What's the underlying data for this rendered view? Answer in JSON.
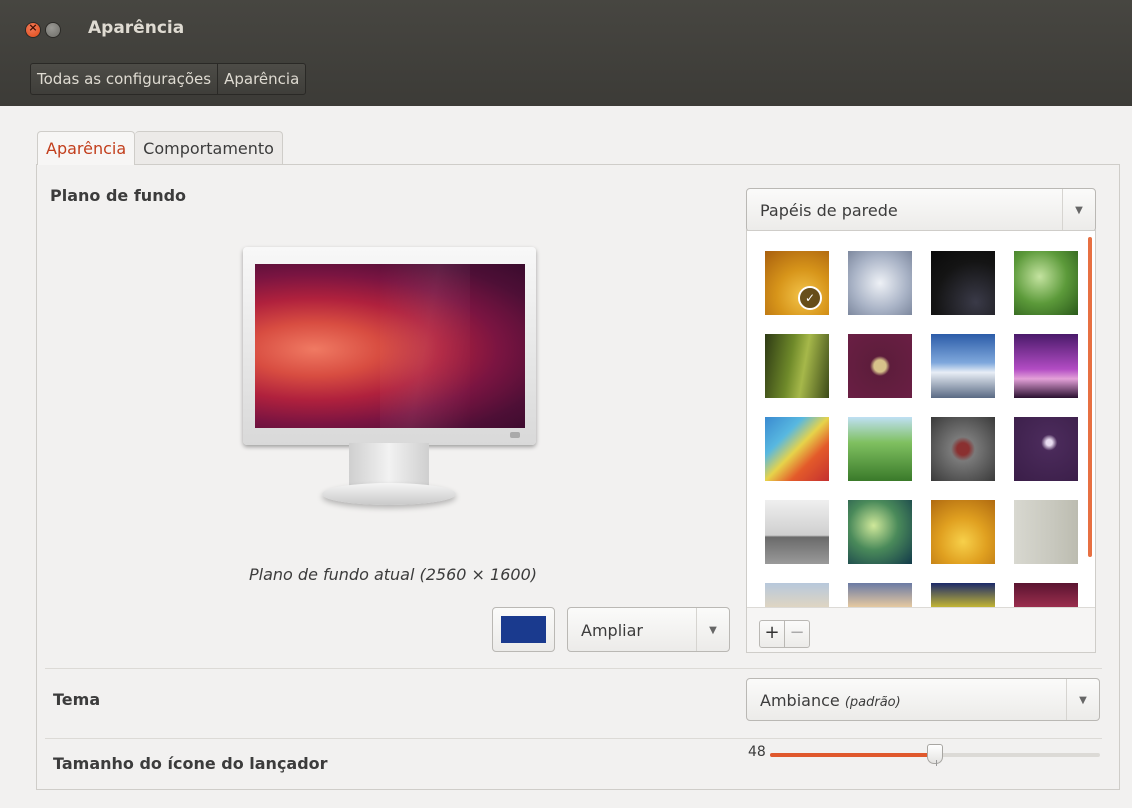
{
  "window": {
    "title": "Aparência"
  },
  "breadcrumb": [
    "Todas as configurações",
    "Aparência"
  ],
  "tabs": [
    {
      "label": "Aparência",
      "active": true
    },
    {
      "label": "Comportamento",
      "active": false
    }
  ],
  "background": {
    "section_label": "Plano de fundo",
    "source_dropdown": "Papéis de parede",
    "caption": "Plano de fundo atual (2560 × 1600)",
    "color_swatch": "#1a3a8e",
    "mode_dropdown": "Ampliar",
    "add_label": "+",
    "remove_label": "−"
  },
  "theme": {
    "label": "Tema",
    "value": "Ambiance",
    "value_note": "(padrão)"
  },
  "launcher": {
    "label": "Tamanho do ícone do lançador",
    "value": "48",
    "fraction": 0.5
  },
  "colors": {
    "accent": "#e0582c",
    "titlebar": "#3c3b37",
    "active_tab": "#c23e1c"
  }
}
